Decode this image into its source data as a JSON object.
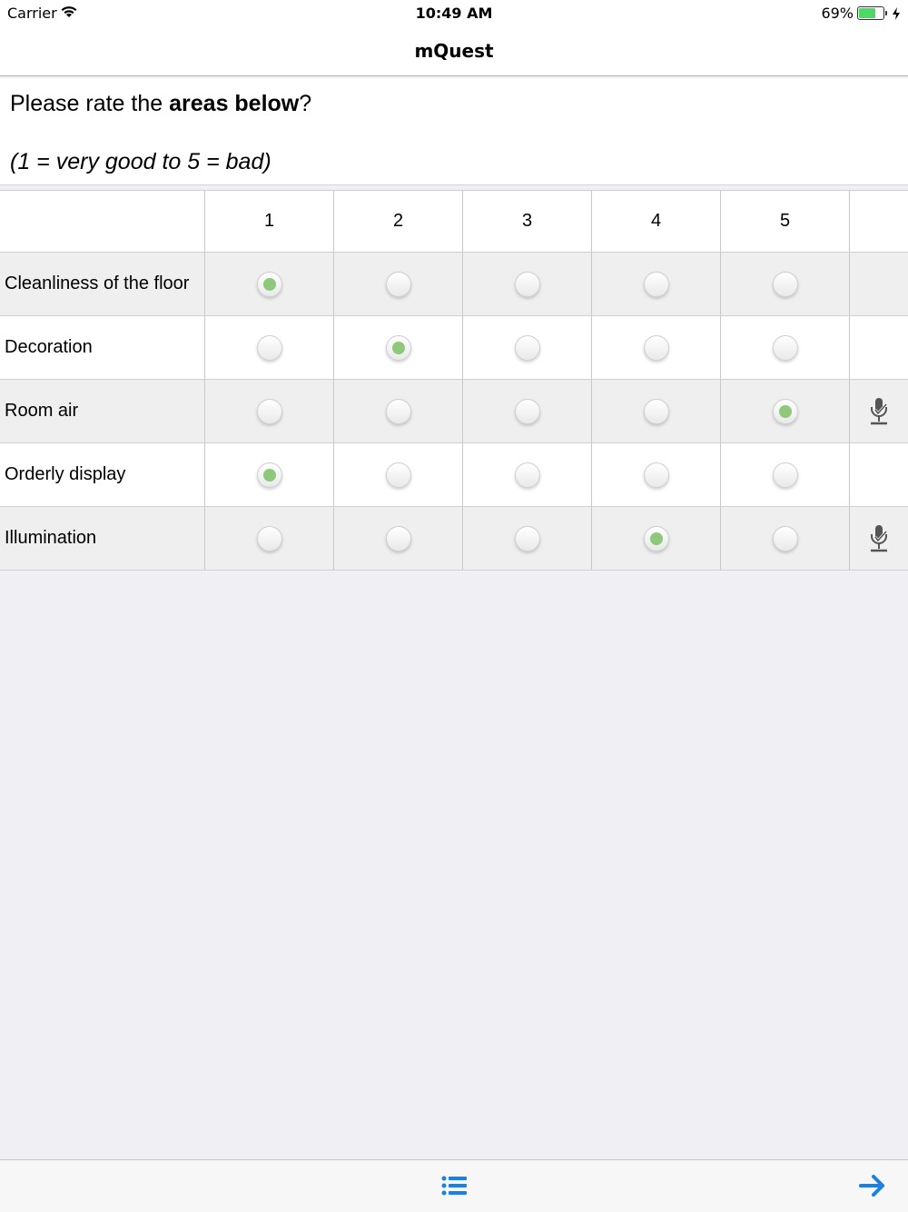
{
  "status_bar": {
    "carrier": "Carrier",
    "time": "10:49 AM",
    "battery_percent": "69%",
    "battery_level": 0.69,
    "icons": [
      "wifi-icon",
      "battery-icon",
      "charging-bolt-icon"
    ]
  },
  "nav": {
    "title": "mQuest"
  },
  "question": {
    "prefix": "Please rate the ",
    "bold": "areas below",
    "suffix": "?",
    "scale_hint": "(1 = very good to 5 = bad)"
  },
  "grid": {
    "columns": [
      "1",
      "2",
      "3",
      "4",
      "5"
    ],
    "rows": [
      {
        "label": "Cleanliness of the floor",
        "selected": 1,
        "shaded": true,
        "mic": false
      },
      {
        "label": "Decoration",
        "selected": 2,
        "shaded": false,
        "mic": false
      },
      {
        "label": "Room air",
        "selected": 5,
        "shaded": true,
        "mic": true
      },
      {
        "label": "Orderly display",
        "selected": 1,
        "shaded": false,
        "mic": false
      },
      {
        "label": "Illumination",
        "selected": 4,
        "shaded": true,
        "mic": true
      }
    ]
  },
  "colors": {
    "accent": "#1a7fe6",
    "selected_dot": "#8ec87a",
    "battery": "#4cd964"
  },
  "toolbar": {
    "icons": [
      "list-icon",
      "arrow-right-icon"
    ]
  }
}
